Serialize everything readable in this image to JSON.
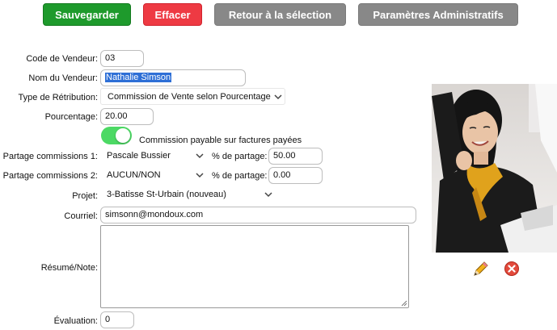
{
  "toolbar": {
    "save_label": "Sauvegarder",
    "clear_label": "Effacer",
    "back_label": "Retour à la sélection",
    "admin_label": "Paramètres Administratifs"
  },
  "form": {
    "vendor_code": {
      "label": "Code de Vendeur:",
      "value": "03"
    },
    "vendor_name": {
      "label": "Nom du Vendeur:",
      "value": "Nathalie Simson"
    },
    "retribution_type": {
      "label": "Type de Rétribution:",
      "value": "Commission de Vente selon Pourcentage"
    },
    "percentage": {
      "label": "Pourcentage:",
      "value": "20.00"
    },
    "commission_toggle": {
      "label": "Commission payable sur factures payées",
      "on": true
    },
    "share1": {
      "label": "Partage commissions 1:",
      "value": "Pascale Bussier",
      "pct_label": "% de partage:",
      "pct_value": "50.00"
    },
    "share2": {
      "label": "Partage commissions 2:",
      "value": "AUCUN/NON",
      "pct_label": "% de partage:",
      "pct_value": "0.00"
    },
    "project": {
      "label": "Projet:",
      "value": "3-Batisse St-Urbain (nouveau)"
    },
    "email": {
      "label": "Courriel:",
      "value": "simsonn@mondoux.com"
    },
    "summary": {
      "label": "Résumé/Note:",
      "value": ""
    },
    "rating": {
      "label": "Évaluation:",
      "value": "0"
    }
  },
  "photo": {
    "edit_icon": "pencil-icon",
    "delete_icon": "delete-circle-icon"
  },
  "colors": {
    "save": "#1e9a2c",
    "clear": "#ee3a43",
    "neutral": "#888888",
    "toggle_on": "#4cd964",
    "selection": "#2e6fd6"
  }
}
